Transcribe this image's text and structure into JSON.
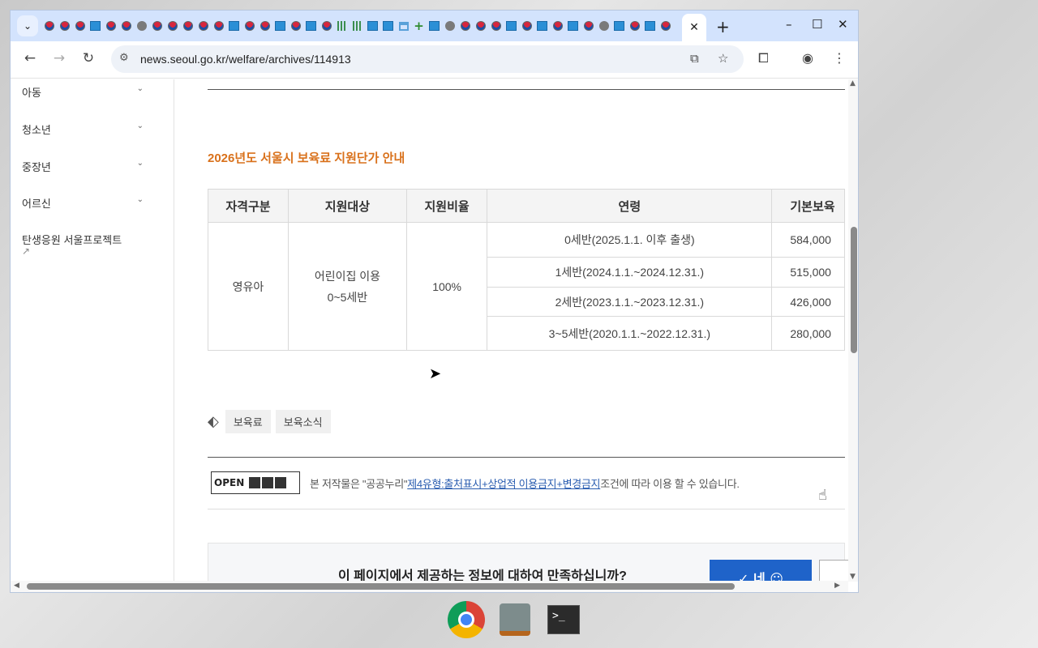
{
  "browser": {
    "tab_search_icon": "chevron-down-icon",
    "active_tab_close": "✕",
    "new_tab": "+",
    "window_controls": [
      "–",
      "☐",
      "✕"
    ],
    "url": "news.seoul.go.kr/welfare/archives/114913",
    "favicons": [
      "gov",
      "gov",
      "gov",
      "seoul",
      "gov",
      "gov",
      "globe",
      "gov",
      "gov",
      "gov",
      "gov",
      "gov",
      "seoul",
      "gov",
      "gov",
      "seoul",
      "gov",
      "seoul",
      "gov",
      "bars",
      "bars",
      "seoul",
      "seoul",
      "house",
      "plus",
      "seoul",
      "globe",
      "gov",
      "gov",
      "gov",
      "seoul",
      "gov",
      "seoul",
      "gov",
      "seoul",
      "gov",
      "globe",
      "seoul",
      "gov",
      "seoul",
      "gov"
    ]
  },
  "sidebar": {
    "items": [
      {
        "label": "아동"
      },
      {
        "label": "청소년"
      },
      {
        "label": "중장년"
      },
      {
        "label": "어르신"
      }
    ],
    "project_link": "탄생응원 서울프로젝트"
  },
  "article": {
    "section_title": "2026년도 서울시 보육료 지원단가 안내",
    "table": {
      "headers": [
        "자격구분",
        "지원대상",
        "지원비율",
        "연령",
        "기본보육"
      ],
      "qualification": "영유아",
      "target_line1": "어린이집 이용",
      "target_line2": "0~5세반",
      "ratio": "100%",
      "rows": [
        {
          "age": "0세반(2025.1.1. 이후 출생)",
          "amount": "584,000"
        },
        {
          "age": "1세반(2024.1.1.~2024.12.31.)",
          "amount": "515,000"
        },
        {
          "age": "2세반(2023.1.1.~2023.12.31.)",
          "amount": "426,000"
        },
        {
          "age": "3~5세반(2020.1.1.~2022.12.31.)",
          "amount": "280,000"
        }
      ]
    },
    "tags": [
      "보육료",
      "보육소식"
    ],
    "license": {
      "logo_text": "OPEN",
      "prefix": "본 저작물은 \"공공누리\"",
      "link": "제4유형:출처표시+상업적 이용금지+변경금지",
      "suffix": "조건에 따라 이용 할 수 있습니다."
    },
    "survey": {
      "question": "이 페이지에서 제공하는 정보에 대하여 만족하십니까?",
      "yes_label": "✓ 네 ☺"
    }
  },
  "taskbar": {
    "apps": [
      "chrome",
      "stamp-app",
      "terminal"
    ],
    "terminal_glyph": ">_"
  }
}
